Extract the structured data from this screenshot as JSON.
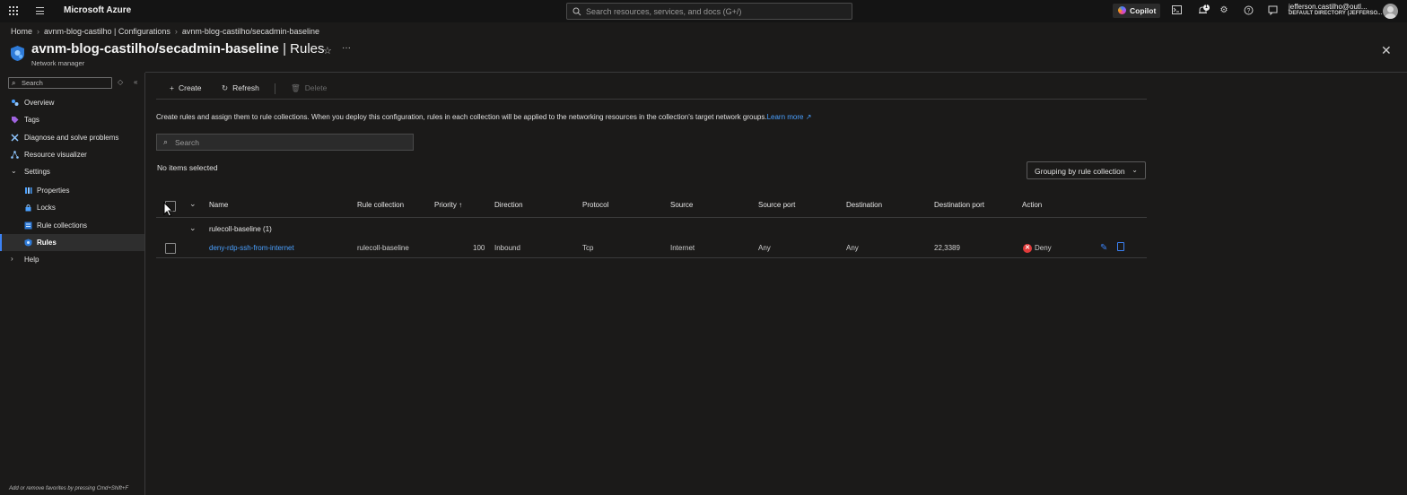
{
  "topbar": {
    "brand": "Microsoft Azure",
    "search_placeholder": "Search resources, services, and docs (G+/)",
    "copilot_label": "Copilot",
    "notification_count": "1",
    "account_email": "jefferson.castilho@outl...",
    "account_directory": "DEFAULT DIRECTORY (JEFFERSO..."
  },
  "breadcrumb": {
    "items": [
      "Home",
      "avnm-blog-castilho | Configurations",
      "avnm-blog-castilho/secadmin-baseline"
    ]
  },
  "page": {
    "title_bold": "avnm-blog-castilho/secadmin-baseline",
    "title_suffix": " | Rules",
    "subtitle": "Network manager"
  },
  "sidebar": {
    "search_placeholder": "Search",
    "items": [
      {
        "label": "Overview",
        "icon": "overview-icon"
      },
      {
        "label": "Tags",
        "icon": "tag-icon"
      },
      {
        "label": "Diagnose and solve problems",
        "icon": "wrench-icon"
      },
      {
        "label": "Resource visualizer",
        "icon": "visualizer-icon"
      },
      {
        "label": "Settings",
        "icon": "chevron-down-icon"
      },
      {
        "label": "Properties",
        "icon": "properties-icon"
      },
      {
        "label": "Locks",
        "icon": "lock-icon"
      },
      {
        "label": "Rule collections",
        "icon": "rule-collections-icon"
      },
      {
        "label": "Rules",
        "icon": "rules-icon",
        "selected": true
      },
      {
        "label": "Help",
        "icon": "chevron-right-icon"
      }
    ],
    "footer_hint": "Add or remove favorites by pressing Cmd+Shift+F"
  },
  "toolbar": {
    "create_label": "Create",
    "refresh_label": "Refresh",
    "delete_label": "Delete"
  },
  "main": {
    "description": "Create rules and assign them to rule collections. When you deploy this configuration, rules in each collection will be applied to the networking resources in the collection's target network groups.",
    "learn_more": "Learn more",
    "search_placeholder": "Search",
    "selection_status": "No items selected",
    "grouping_label": "Grouping by rule collection"
  },
  "table": {
    "columns": [
      "Name",
      "Rule collection",
      "Priority ↑",
      "Direction",
      "Protocol",
      "Source",
      "Source port",
      "Destination",
      "Destination port",
      "Action"
    ],
    "group_label": "rulecoll-baseline (1)",
    "rows": [
      {
        "name": "deny-rdp-ssh-from-internet",
        "rule_collection": "rulecoll-baseline",
        "priority": "100",
        "direction": "Inbound",
        "protocol": "Tcp",
        "source": "Internet",
        "source_port": "Any",
        "destination": "Any",
        "destination_port": "22,3389",
        "action": "Deny"
      }
    ]
  },
  "colors": {
    "accent": "#3b82f6",
    "link": "#4aa0ff",
    "deny": "#e23b3b",
    "background": "#1b1a19"
  }
}
